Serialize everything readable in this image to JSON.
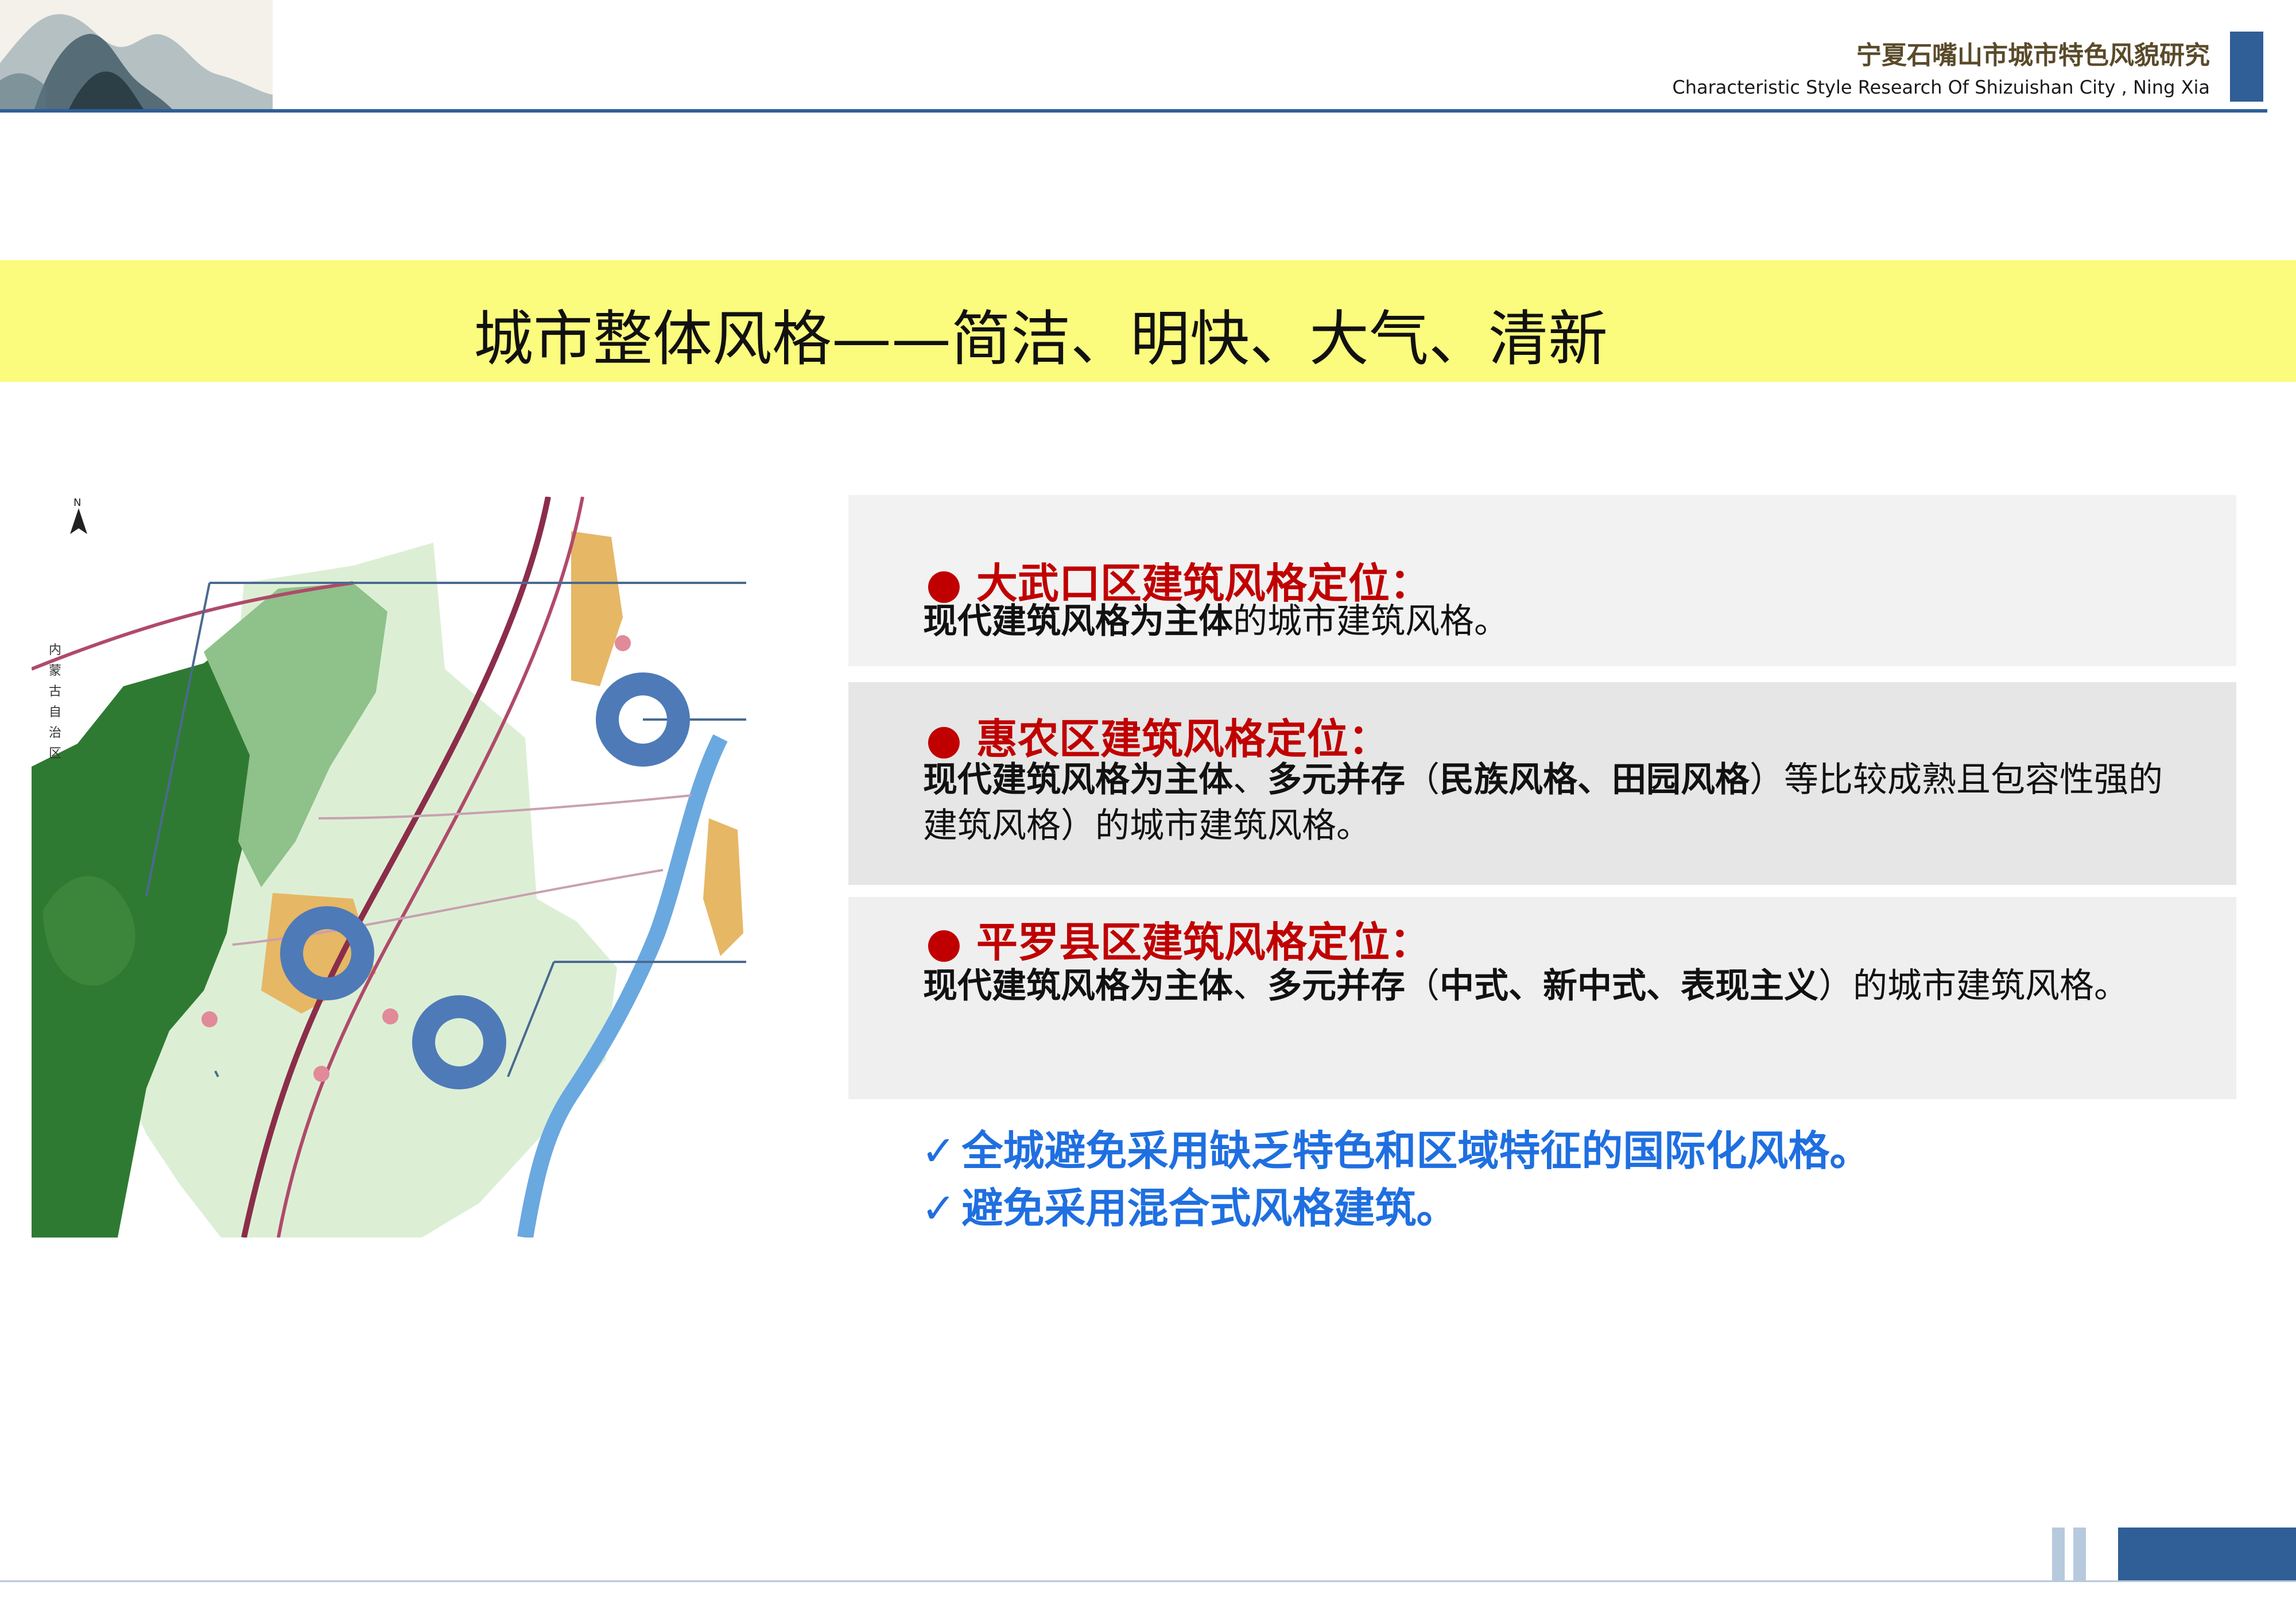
{
  "header": {
    "title": "宁夏石嘴山市城市特色风貌研究",
    "subtitle": "Characteristic  Style Research Of Shizuishan City , Ning Xia"
  },
  "banner": {
    "text": "城市整体风格——简洁、明快、大气、清新"
  },
  "map": {
    "north_label": "N",
    "region_label": "内蒙古自治区"
  },
  "panels": [
    {
      "bullet": "●",
      "title": "大武口区建筑风格定位：",
      "body_bold": "现代建筑风格为主体",
      "body_rest": "的城市建筑风格。"
    },
    {
      "bullet": "●",
      "title": "惠农区建筑风格定位：",
      "seg1": "现代建筑风格为主体",
      "seg2": "、",
      "seg3": "多元并存",
      "seg4": "（",
      "seg5": "民族风格、田园风格",
      "seg6": "）等比较成熟且包容性强的建筑风格）的城市建筑风格。"
    },
    {
      "bullet": "●",
      "title": "平罗县区建筑风格定位：",
      "seg1": "现代建筑风格为主体",
      "seg2": "、",
      "seg3": "多元并存",
      "seg4": "（",
      "seg5": "中式、新中式、表现主义",
      "seg6": "）的城市建筑风格。"
    }
  ],
  "checks": [
    {
      "mark": "✓",
      "text": "全城避免采用缺乏特色和区域特征的国际化风格。"
    },
    {
      "mark": "✓",
      "text": "避免采用混合式风格建筑。"
    }
  ],
  "colors": {
    "accent_blue": "#2f5f96",
    "banner_yellow": "#fbfb7d",
    "title_red": "#c00000",
    "check_blue": "#1f6fe0"
  }
}
